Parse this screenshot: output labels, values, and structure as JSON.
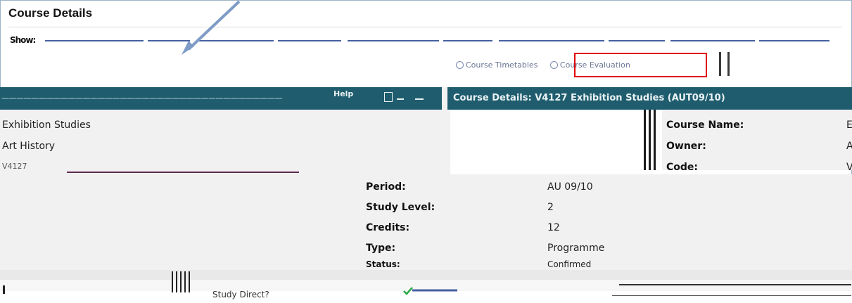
{
  "header": {
    "title": "Course Details",
    "show_label": "Show:"
  },
  "options": [
    {
      "label": "Course Timetables"
    },
    {
      "label": "Course Evaluation"
    }
  ],
  "left_panel": {
    "help_label": "Help",
    "items": [
      "Exhibition Studies",
      "Art History",
      "V4127"
    ]
  },
  "right_panel": {
    "header": "Course Details: V4127 Exhibition Studies (AUT09/10)",
    "labels": [
      "Course Name:",
      "Owner:",
      "Code:"
    ],
    "values": [
      "E",
      "A",
      "V"
    ]
  },
  "details": [
    {
      "label": "Period:",
      "value": "AU 09/10"
    },
    {
      "label": "Study Level:",
      "value": "2"
    },
    {
      "label": "Credits:",
      "value": "12"
    },
    {
      "label": "Type:",
      "value": "Programme"
    },
    {
      "label": "Status:",
      "value": "Confirmed"
    }
  ],
  "footer": {
    "study_direct_label": "Study Direct?"
  },
  "colors": {
    "panel": "#1f5d6e",
    "highlight": "#e00000",
    "arrow": "#7f9cc7",
    "check": "#2aa843"
  }
}
